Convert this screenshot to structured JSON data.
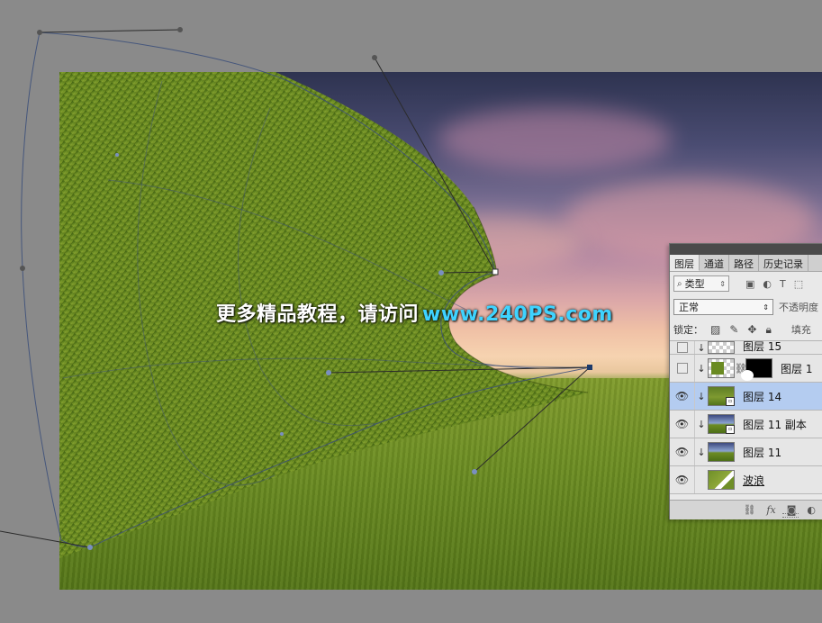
{
  "watermark": {
    "chinese": "更多精品教程，请访问",
    "url": "www.240PS.com"
  },
  "layers_panel": {
    "tabs": [
      {
        "label": "图层"
      },
      {
        "label": "通道"
      },
      {
        "label": "路径"
      },
      {
        "label": "历史记录"
      }
    ],
    "filter": {
      "label": "类型",
      "icon": "search-icon"
    },
    "filter_icons": [
      "image-filter-icon",
      "adjustment-filter-icon",
      "type-filter-icon",
      "shape-filter-icon"
    ],
    "blend_mode": "正常",
    "opacity_label": "不透明度",
    "lock_label": "锁定：",
    "fill_label": "填充",
    "layers": [
      {
        "name": "图层 15",
        "visible": false,
        "clipped": true,
        "thumb": "checker"
      },
      {
        "name": "图层 1",
        "visible": false,
        "clipped": true,
        "thumb": "grass",
        "has_mask": true
      },
      {
        "name": "图层 14",
        "visible": true,
        "clipped": true,
        "thumb": "grass",
        "selected": true,
        "smart_object": true
      },
      {
        "name": "图层 11 副本",
        "visible": true,
        "clipped": true,
        "thumb": "sky-grass",
        "smart_object": true
      },
      {
        "name": "图层 11",
        "visible": true,
        "clipped": true,
        "thumb": "sky-grass"
      },
      {
        "name": "波浪",
        "visible": true,
        "clipped": false,
        "thumb": "wave",
        "underline": true
      }
    ],
    "footer_icons": [
      "link-icon",
      "fx-icon",
      "mask-icon",
      "adjustment-icon"
    ],
    "footer_fx": "fx"
  },
  "colors": {
    "selection": "#b4ccf0",
    "path_color": "#1d3a6b",
    "watermark_url": "#3fd3ff",
    "workspace": "#8a8a8a"
  }
}
